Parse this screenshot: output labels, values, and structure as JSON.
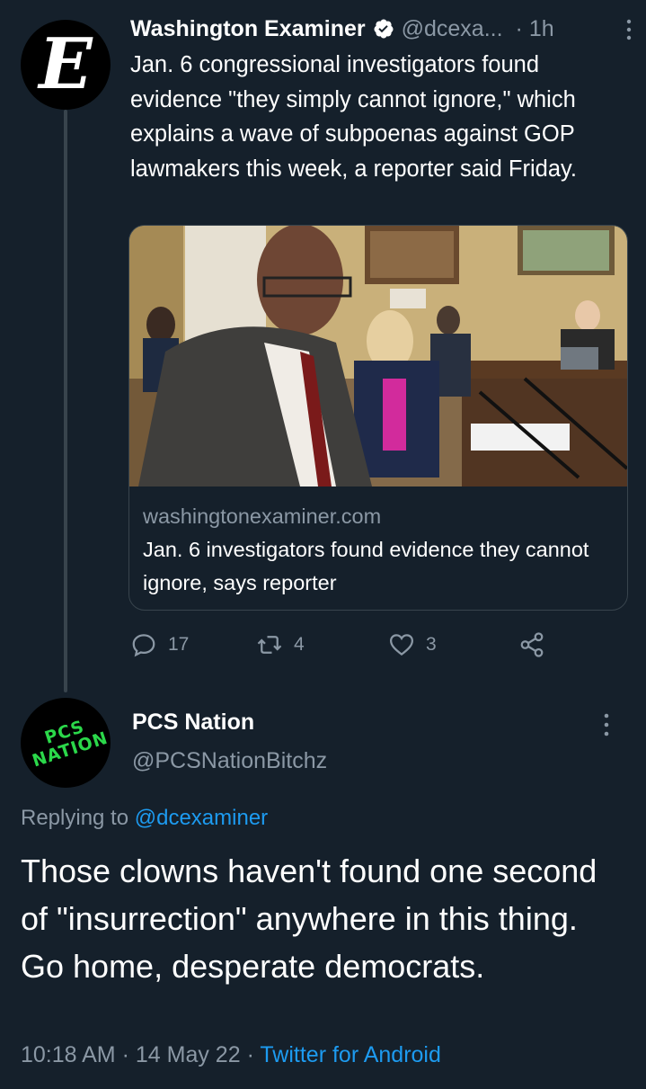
{
  "tweet1": {
    "author_name": "Washington Examiner",
    "author_handle": "@dcexa...",
    "separator": "·",
    "time": "1h",
    "avatar_letter": "E",
    "text": "Jan. 6 congressional investigators found evidence \"they simply cannot ignore,\" which explains a wave of subpoenas against GOP lawmakers this week, a reporter said Friday.",
    "card": {
      "domain": "washingtonexaminer.com",
      "headline": "Jan. 6 investigators found evidence they cannot ignore, says reporter"
    },
    "actions": {
      "replies": "17",
      "retweets": "4",
      "likes": "3"
    }
  },
  "tweet2": {
    "author_name": "PCS Nation",
    "author_handle": "@PCSNationBitchz",
    "avatar_line1": "PCS",
    "avatar_line2": "NATION",
    "replying_label": "Replying to",
    "replying_to": "@dcexaminer",
    "text_line1": "Those clowns haven't found one second of \"insurrection\" anywhere in this thing.",
    "text_line2": "Go home, desperate democrats.",
    "time": "10:18 AM",
    "date": "14 May 22",
    "separator": "·",
    "client": "Twitter for Android"
  },
  "colors": {
    "background": "#15202b",
    "secondary_text": "#8b98a5",
    "accent_blue": "#1d9bf0",
    "logo_green": "#2bd84a"
  },
  "icons": [
    "verified-badge-icon",
    "more-vertical-icon",
    "reply-icon",
    "retweet-icon",
    "like-icon",
    "share-icon"
  ]
}
